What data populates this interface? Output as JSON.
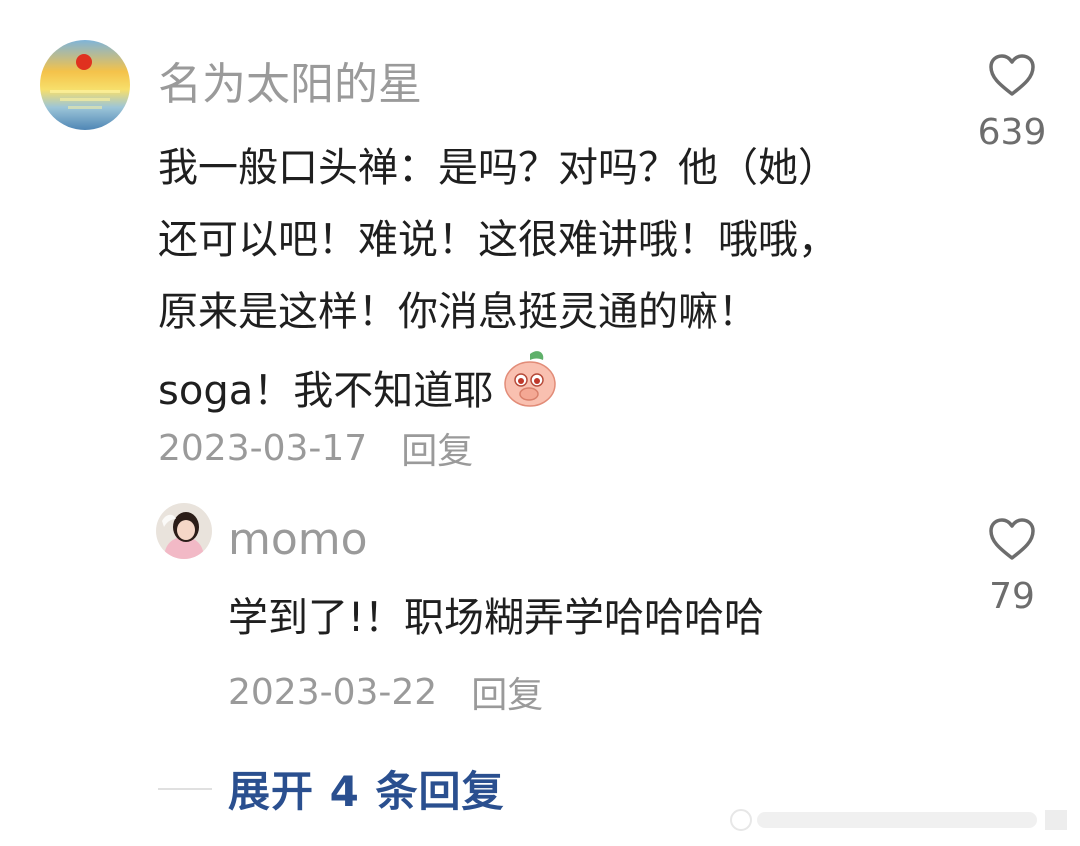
{
  "comment": {
    "username": "名为太阳的星",
    "lines": [
      "我一般口头禅：是吗？对吗？他（她）",
      "还可以吧！难说！这很难讲哦！哦哦，",
      "原来是这样！你消息挺灵通的嘛！",
      "soga！我不知道耶"
    ],
    "emoji": "peach-emoji",
    "date": "2023-03-17",
    "reply_label": "回复",
    "like_count": "639"
  },
  "reply": {
    "username": "momo",
    "text": "学到了!！职场糊弄学哈哈哈哈",
    "date": "2023-03-22",
    "reply_label": "回复",
    "like_count": "79"
  },
  "expand_label": "展开 4 条回复",
  "colors": {
    "name": "#9a9a9a",
    "text": "#1f1f1f",
    "link": "#2a4f8f",
    "icon": "#6d6d6d"
  }
}
